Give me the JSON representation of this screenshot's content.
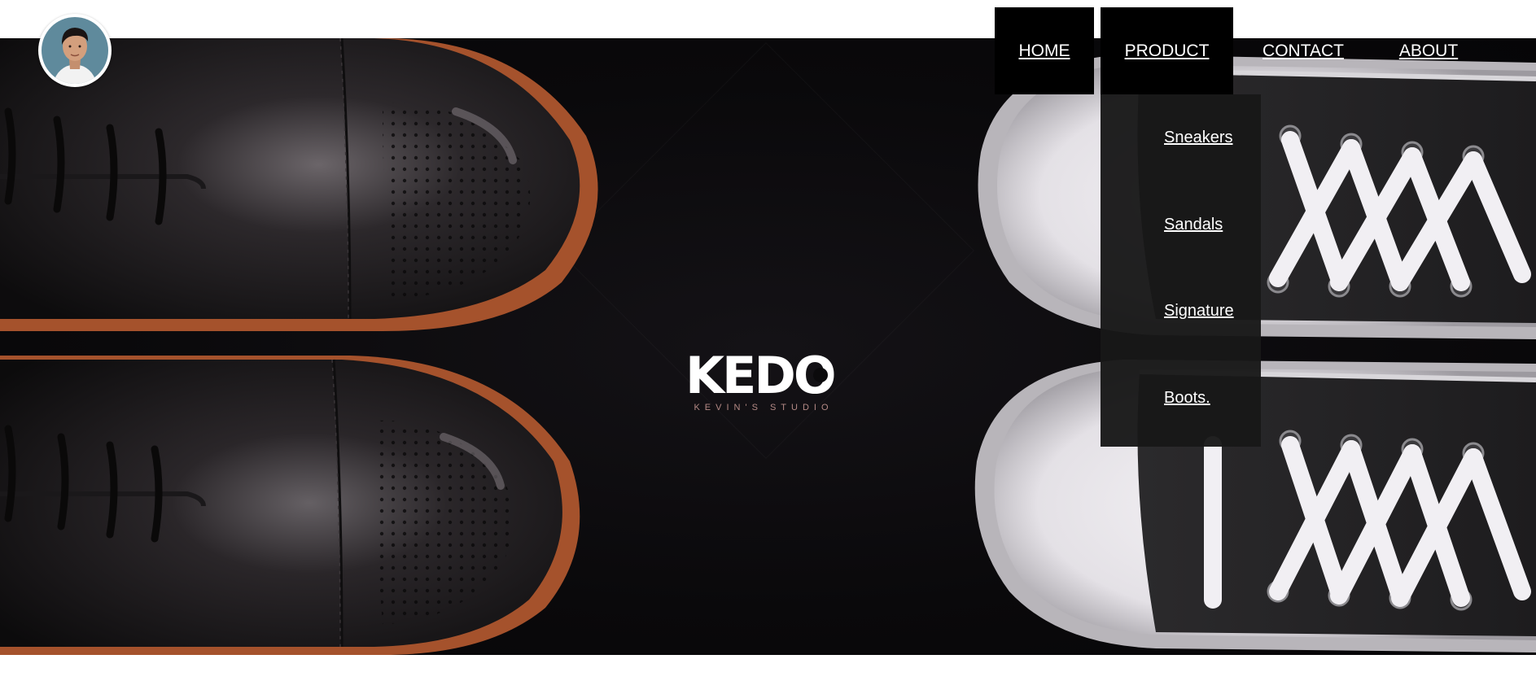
{
  "nav": {
    "home": "HOME",
    "product": "PRODUCT",
    "contact": "CONTACT",
    "about": "ABOUT"
  },
  "dropdown": {
    "items": [
      "Sneakers",
      "Sandals",
      "Signature",
      "Boots."
    ]
  },
  "hero": {
    "logo_text": "KEDO",
    "logo_subtitle": "KEVIN'S STUDIO"
  },
  "colors": {
    "nav_bg": "#000000",
    "dropdown_bg": "#181818",
    "hero_bg": "#0b0a0c",
    "text": "#ffffff",
    "logo_sub": "#b58a86",
    "leather_rim": "#a5522c"
  },
  "icons": {
    "avatar": "profile-avatar"
  }
}
